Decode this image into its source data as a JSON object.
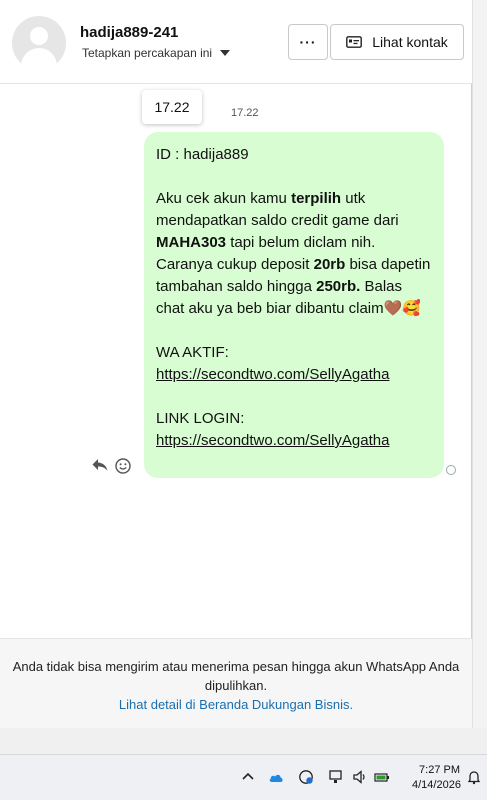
{
  "header": {
    "contact_name": "hadija889-241",
    "label_action": "Tetapkan percakapan ini",
    "more_label": "···",
    "view_contact_label": "Lihat kontak"
  },
  "message": {
    "tooltip_time": "17.22",
    "time": "17.22",
    "line_id": "ID : hadija889",
    "para1_a": "Aku cek akun kamu ",
    "para1_b": "terpilih",
    "para1_c": " utk mendapatkan saldo credit game dari ",
    "para1_d": "MAHA303",
    "para1_e": " tapi belum diclam nih. Caranya cukup deposit ",
    "para1_f": "20rb",
    "para1_g": " bisa dapetin tambahan saldo hingga ",
    "para1_h": "250rb.",
    "para1_i": " Balas chat aku ya beb biar dibantu claim",
    "para1_emoji": "🤎🥰",
    "wa_label": "WA AKTIF:",
    "wa_link": "https://secondtwo.com/SellyAgatha",
    "login_label": "LINK LOGIN:",
    "login_link": "https://secondtwo.com/SellyAgatha"
  },
  "footer": {
    "notice": "Anda tidak bisa mengirim atau menerima pesan hingga akun WhatsApp Anda dipulihkan.",
    "link": "Lihat detail di Beranda Dukungan Bisnis."
  },
  "taskbar": {
    "time": "7:27 PM",
    "date": "4/14/2026"
  },
  "colors": {
    "bubble": "#d9fdd3",
    "link": "#1a6fb0"
  }
}
